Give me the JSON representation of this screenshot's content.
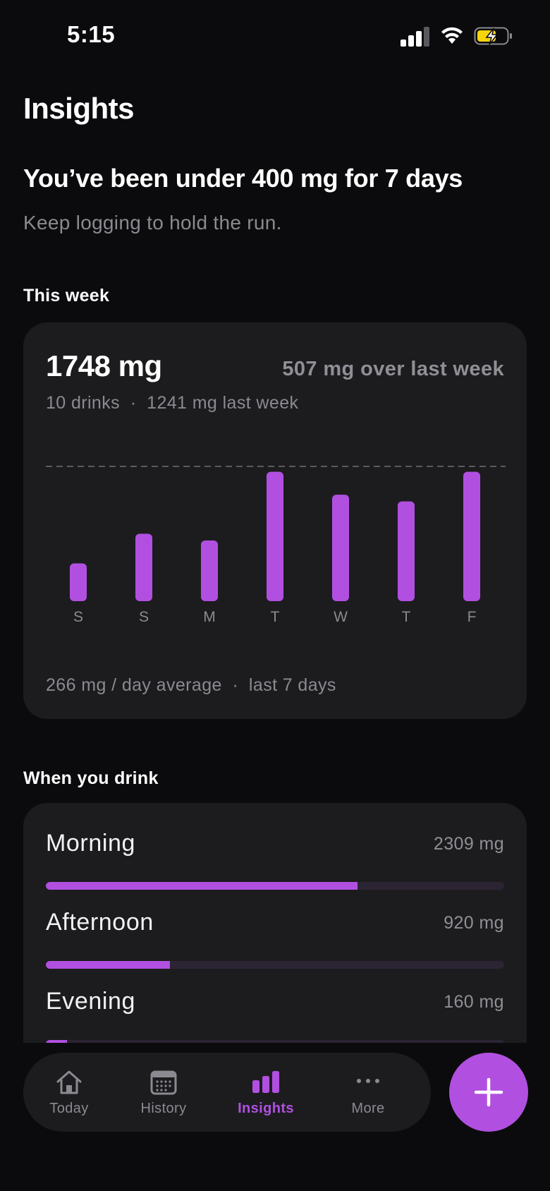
{
  "status_bar": {
    "time": "5:15"
  },
  "header": {
    "title": "Insights"
  },
  "streak": {
    "title": "You’ve been under 400 mg for 7 days",
    "subtitle": "Keep logging to hold the run."
  },
  "week": {
    "section_label": "This week",
    "total": "1748 mg",
    "comparison": "507 mg over last week",
    "meta": "10 drinks  ·  1241 mg last week",
    "footer": "266 mg / day average  ·  last 7 days"
  },
  "chart_data": {
    "type": "bar",
    "categories": [
      "S",
      "S",
      "M",
      "T",
      "W",
      "T",
      "F"
    ],
    "values": [
      140,
      250,
      225,
      480,
      395,
      370,
      480
    ],
    "reference_line": 500,
    "ylim": [
      0,
      500
    ],
    "grid": false,
    "color": "#b150e0"
  },
  "time_of_day": {
    "section_label": "When you drink",
    "periods": [
      {
        "name": "Morning",
        "value": "2309 mg",
        "fraction": 0.68
      },
      {
        "name": "Afternoon",
        "value": "920 mg",
        "fraction": 0.27
      },
      {
        "name": "Evening",
        "value": "160 mg",
        "fraction": 0.046
      }
    ]
  },
  "tabs": [
    {
      "label": "Today",
      "icon": "home-icon",
      "active": false
    },
    {
      "label": "History",
      "icon": "calendar-icon",
      "active": false
    },
    {
      "label": "Insights",
      "icon": "bar-chart-icon",
      "active": true
    },
    {
      "label": "More",
      "icon": "more-icon",
      "active": false
    }
  ],
  "colors": {
    "accent": "#b150e0",
    "background": "#0b0b0d",
    "card": "#1c1c1f",
    "battery_charging": "#f5d50a"
  }
}
